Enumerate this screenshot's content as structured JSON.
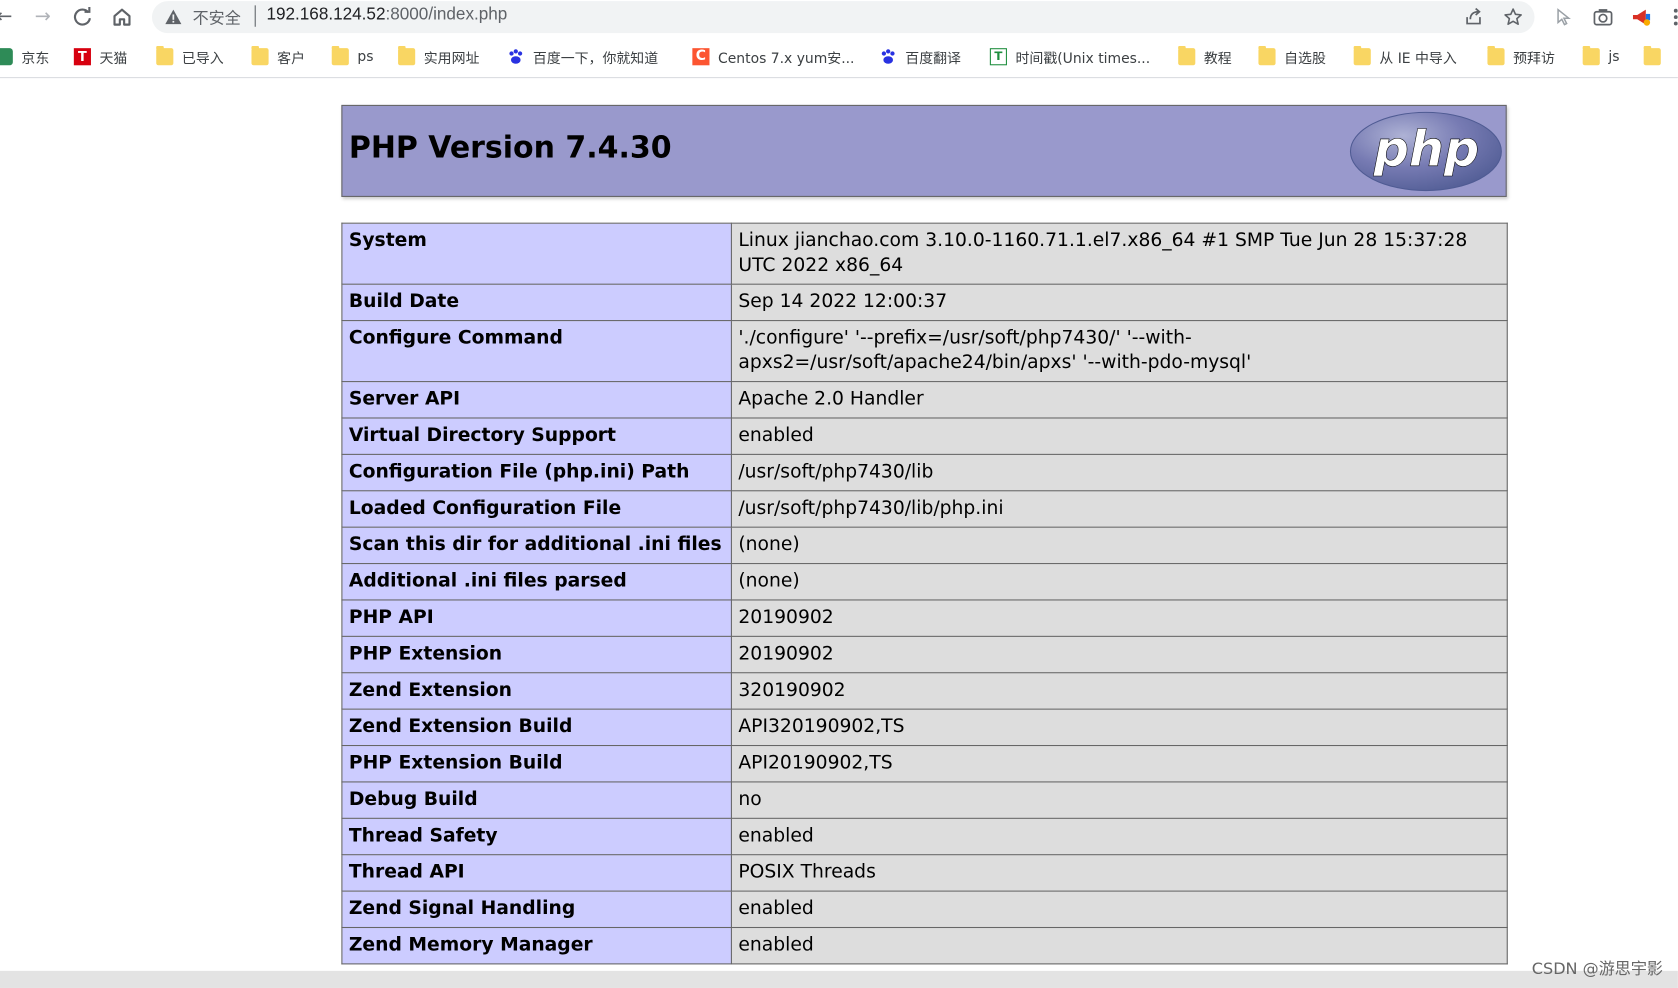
{
  "browser": {
    "insecure_label": "不安全",
    "url_host": "192.168.124.52",
    "url_rest": ":8000/index.php"
  },
  "bookmarks": [
    {
      "label": "京东",
      "icon": "jd-icon"
    },
    {
      "label": "天猫",
      "icon": "tmall-icon"
    },
    {
      "label": "已导入",
      "icon": "folder-icon"
    },
    {
      "label": "客户",
      "icon": "folder-icon"
    },
    {
      "label": "ps",
      "icon": "folder-icon"
    },
    {
      "label": "实用网址",
      "icon": "folder-icon"
    },
    {
      "label": "百度一下，你就知道",
      "icon": "baidu-icon"
    },
    {
      "label": "Centos 7.x yum安...",
      "icon": "csdn-icon"
    },
    {
      "label": "百度翻译",
      "icon": "baidu-icon"
    },
    {
      "label": "时间戳(Unix times...",
      "icon": "timestamp-icon"
    },
    {
      "label": "教程",
      "icon": "folder-icon"
    },
    {
      "label": "自选股",
      "icon": "folder-icon"
    },
    {
      "label": "从 IE 中导入",
      "icon": "folder-icon"
    },
    {
      "label": "预拜访",
      "icon": "folder-icon"
    },
    {
      "label": "js",
      "icon": "folder-icon"
    }
  ],
  "phpinfo": {
    "title": "PHP Version 7.4.30",
    "logo_text": "php",
    "rows": [
      {
        "key": "System",
        "value": "Linux jianchao.com 3.10.0-1160.71.1.el7.x86_64 #1 SMP Tue Jun 28 15:37:28 UTC 2022 x86_64"
      },
      {
        "key": "Build Date",
        "value": "Sep 14 2022 12:00:37"
      },
      {
        "key": "Configure Command",
        "value": "'./configure' '--prefix=/usr/soft/php7430/' '--with-apxs2=/usr/soft/apache24/bin/apxs' '--with-pdo-mysql'"
      },
      {
        "key": "Server API",
        "value": "Apache 2.0 Handler"
      },
      {
        "key": "Virtual Directory Support",
        "value": "enabled"
      },
      {
        "key": "Configuration File (php.ini) Path",
        "value": "/usr/soft/php7430/lib"
      },
      {
        "key": "Loaded Configuration File",
        "value": "/usr/soft/php7430/lib/php.ini"
      },
      {
        "key": "Scan this dir for additional .ini files",
        "value": "(none)"
      },
      {
        "key": "Additional .ini files parsed",
        "value": "(none)"
      },
      {
        "key": "PHP API",
        "value": "20190902"
      },
      {
        "key": "PHP Extension",
        "value": "20190902"
      },
      {
        "key": "Zend Extension",
        "value": "320190902"
      },
      {
        "key": "Zend Extension Build",
        "value": "API320190902,TS"
      },
      {
        "key": "PHP Extension Build",
        "value": "API20190902,TS"
      },
      {
        "key": "Debug Build",
        "value": "no"
      },
      {
        "key": "Thread Safety",
        "value": "enabled"
      },
      {
        "key": "Thread API",
        "value": "POSIX Threads"
      },
      {
        "key": "Zend Signal Handling",
        "value": "enabled"
      },
      {
        "key": "Zend Memory Manager",
        "value": "enabled"
      }
    ]
  },
  "watermark": "CSDN @游思宇影",
  "colors": {
    "header_bg": "#9999cc",
    "key_cell_bg": "#ccccff",
    "value_cell_bg": "#dddddd",
    "border": "#666666"
  }
}
